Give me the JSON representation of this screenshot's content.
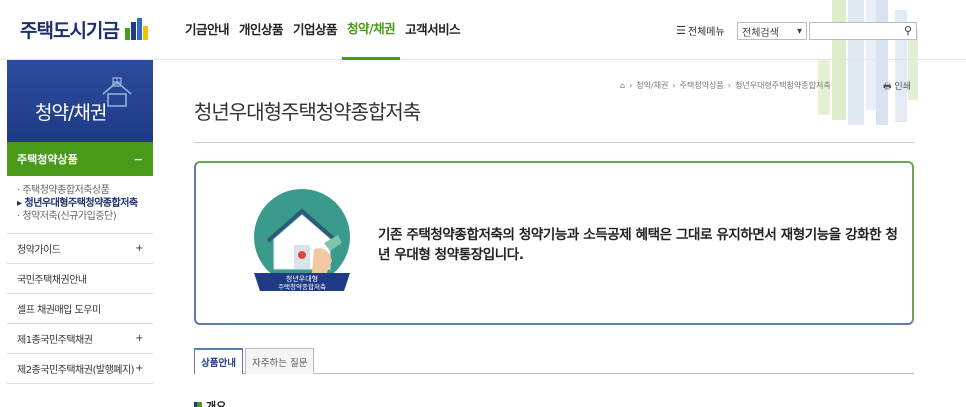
{
  "header": {
    "logo_text": "주택도시기금",
    "nav": [
      "기금안내",
      "개인상품",
      "기업상품",
      "청약/채권",
      "고객서비스"
    ],
    "active_nav": "청약/채권",
    "allmenu_label": "전체메뉴",
    "search_select": "전체검색",
    "search_placeholder": ""
  },
  "lnb": {
    "title": "청약/채권",
    "category": "주택청약상품",
    "category_toggle": "−",
    "sub_items": [
      "· 주택청약종합저축상품",
      "▸ 청년우대형주택청약종합저축",
      "· 청약저축(신규가입중단)"
    ],
    "rows": [
      {
        "label": "청약가이드",
        "toggle": "+"
      },
      {
        "label": "국민주택채권안내",
        "toggle": ""
      },
      {
        "label": "셀프 채권매입 도우미",
        "toggle": ""
      },
      {
        "label": "제1종국민주택채권",
        "toggle": "+"
      },
      {
        "label": "제2종국민주택채권(발행폐지)",
        "toggle": "+"
      }
    ]
  },
  "breadcrumb": [
    "청약/채권",
    "주택청약상품",
    "청년우대형주택청약종합저축"
  ],
  "print_label": "인쇄",
  "page_title": "청년우대형주택청약종합저축",
  "intro": {
    "badge_line1": "청년우대형",
    "badge_line2": "주택청약종합저축",
    "text": "기존 주택청약종합저축의 청약기능과 소득공제 혜택은 그대로 유지하면서 재형기능을 강화한 청년 우대형 청약통장입니다."
  },
  "tabs": [
    "상품안내",
    "자주하는 질문"
  ],
  "section_heading": "개요",
  "colors": {
    "brand_blue": "#1f3b86",
    "brand_green": "#4a9a1a",
    "deco_green": "#c8e6a0",
    "deco_blue": "#c4d6ee"
  }
}
